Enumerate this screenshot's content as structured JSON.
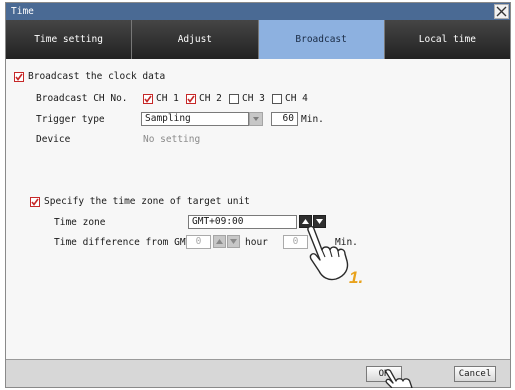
{
  "window": {
    "title": "Time",
    "close_icon": "close-icon"
  },
  "tabs": [
    {
      "label": "Time setting",
      "active": false
    },
    {
      "label": "Adjust",
      "active": false
    },
    {
      "label": "Broadcast",
      "active": true
    },
    {
      "label": "Local time",
      "active": false
    }
  ],
  "broadcast": {
    "enable_label": "Broadcast the clock data",
    "enable_checked": true,
    "ch_label": "Broadcast CH No.",
    "channels": [
      {
        "label": "CH 1",
        "checked": true
      },
      {
        "label": "CH 2",
        "checked": true
      },
      {
        "label": "CH 3",
        "checked": false
      },
      {
        "label": "CH 4",
        "checked": false
      }
    ],
    "trigger_label": "Trigger type",
    "trigger_value": "Sampling",
    "interval_value": "60",
    "interval_unit": "Min.",
    "device_label": "Device",
    "device_value": "No setting"
  },
  "timezone": {
    "enable_label": "Specify the time zone of target unit",
    "enable_checked": true,
    "zone_label": "Time zone",
    "zone_value": "GMT+09:00",
    "diff_label": "Time difference from GMT",
    "hour_value": "0",
    "hour_unit": "hour",
    "min_value": "0",
    "min_unit": "Min."
  },
  "annotation": {
    "step": "1."
  },
  "footer": {
    "ok_label": "OK",
    "cancel_label": "Cancel"
  },
  "colors": {
    "title_bar": "#4a6a94",
    "active_tab": "#8db1e0",
    "check_mark": "#c62828",
    "annotation": "#e8a21c"
  }
}
